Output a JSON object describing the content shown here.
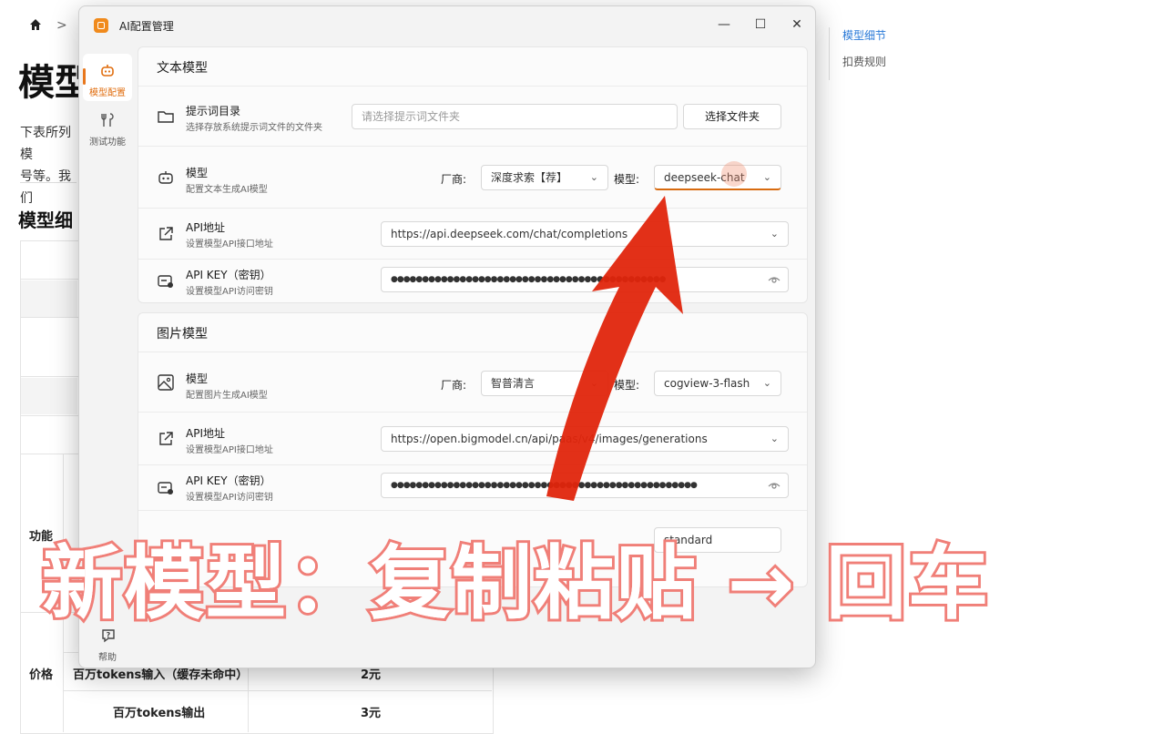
{
  "background_page": {
    "breadcrumb_sep": ">",
    "title": "模型",
    "intro_lines": [
      "下表所列模",
      "号等。我们"
    ],
    "section_title": "模型细",
    "toc": [
      "模型细节",
      "扣费规则"
    ],
    "table": {
      "row_labels": [
        "功能",
        "价格"
      ],
      "rows": [
        {
          "label": "百万tokens输入（缓存未命中）",
          "value": "2元"
        },
        {
          "label": "百万tokens输出",
          "value": "3元"
        }
      ]
    }
  },
  "window": {
    "title": "AI配置管理",
    "nav": [
      {
        "label": "模型配置",
        "icon": "robot-icon"
      },
      {
        "label": "测试功能",
        "icon": "tools-icon"
      }
    ],
    "help_label": "帮助"
  },
  "text_model": {
    "heading": "文本模型",
    "prompt_dir": {
      "title": "提示词目录",
      "subtitle": "选择存放系统提示词文件的文件夹",
      "placeholder": "请选择提示词文件夹",
      "button": "选择文件夹"
    },
    "model": {
      "title": "模型",
      "subtitle": "配置文本生成AI模型",
      "vendor_label": "厂商:",
      "vendor_value": "深度求索【荐】",
      "model_label": "模型:",
      "model_value": "deepseek-chat"
    },
    "api_url": {
      "title": "API地址",
      "subtitle": "设置模型API接口地址",
      "value": "https://api.deepseek.com/chat/completions"
    },
    "api_key": {
      "title": "API KEY（密钥）",
      "subtitle": "设置模型API访问密钥",
      "value": "●●●●●●●●●●●●●●●●●●●●●●●●●●●●●●●●●●●●●●●●●●●●"
    }
  },
  "image_model": {
    "heading": "图片模型",
    "model": {
      "title": "模型",
      "subtitle": "配置图片生成AI模型",
      "vendor_label": "厂商:",
      "vendor_value": "智普清言",
      "model_label": "模型:",
      "model_value": "cogview-3-flash"
    },
    "api_url": {
      "title": "API地址",
      "subtitle": "设置模型API接口地址",
      "value": "https://open.bigmodel.cn/api/paas/v4/images/generations"
    },
    "api_key": {
      "title": "API KEY（密钥）",
      "subtitle": "设置模型API访问密钥",
      "value": "●●●●●●●●●●●●●●●●●●●●●●●●●●●●●●●●●●●●●●●●●●●●●●●●●"
    },
    "partial_row_value": "standard"
  },
  "overlay": {
    "caption": "新模型：复制粘贴 → 回车",
    "caption_color": "#f07f78",
    "arrow_color": "#e0250c"
  },
  "colors": {
    "accent": "#e8771c"
  }
}
